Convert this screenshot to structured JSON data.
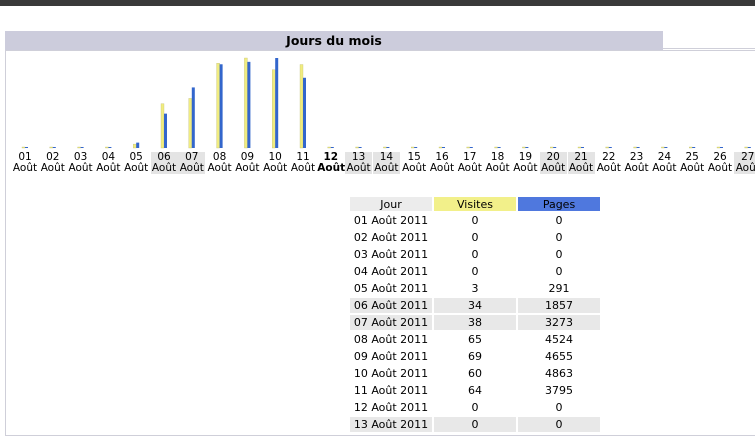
{
  "title": "Jours du mois",
  "colors": {
    "visits": "#f0ec80",
    "pages": "#3366cc",
    "header": "#ccccdc"
  },
  "chart_data": {
    "type": "bar",
    "categories": [
      "01",
      "02",
      "03",
      "04",
      "05",
      "06",
      "07",
      "08",
      "09",
      "10",
      "11",
      "12",
      "13",
      "14",
      "15",
      "16",
      "17",
      "18",
      "19",
      "20",
      "21",
      "22",
      "23",
      "24",
      "25",
      "26",
      "27"
    ],
    "month_label": "Août",
    "series": [
      {
        "name": "Visites",
        "values": [
          0,
          0,
          0,
          0,
          3,
          34,
          38,
          65,
          69,
          60,
          64,
          0,
          0,
          0,
          0,
          0,
          0,
          0,
          0,
          0,
          0,
          0,
          0,
          0,
          0,
          0,
          0
        ]
      },
      {
        "name": "Pages",
        "values": [
          0,
          0,
          0,
          0,
          291,
          1857,
          3273,
          4524,
          4655,
          4863,
          3795,
          0,
          0,
          0,
          0,
          0,
          0,
          0,
          0,
          0,
          0,
          0,
          0,
          0,
          0,
          0,
          0
        ]
      }
    ],
    "weekend_days": [
      "06",
      "07",
      "13",
      "14",
      "20",
      "21",
      "27"
    ],
    "today": "12"
  },
  "table": {
    "headers": [
      "Jour",
      "Visites",
      "Pages"
    ],
    "rows": [
      [
        "01 Août 2011",
        "0",
        "0"
      ],
      [
        "02 Août 2011",
        "0",
        "0"
      ],
      [
        "03 Août 2011",
        "0",
        "0"
      ],
      [
        "04 Août 2011",
        "0",
        "0"
      ],
      [
        "05 Août 2011",
        "3",
        "291"
      ],
      [
        "06 Août 2011",
        "34",
        "1857"
      ],
      [
        "07 Août 2011",
        "38",
        "3273"
      ],
      [
        "08 Août 2011",
        "65",
        "4524"
      ],
      [
        "09 Août 2011",
        "69",
        "4655"
      ],
      [
        "10 Août 2011",
        "60",
        "4863"
      ],
      [
        "11 Août 2011",
        "64",
        "3795"
      ],
      [
        "12 Août 2011",
        "0",
        "0"
      ],
      [
        "13 Août 2011",
        "0",
        "0"
      ]
    ],
    "weekend_rows": [
      5,
      6,
      12
    ],
    "today_row": 11
  }
}
